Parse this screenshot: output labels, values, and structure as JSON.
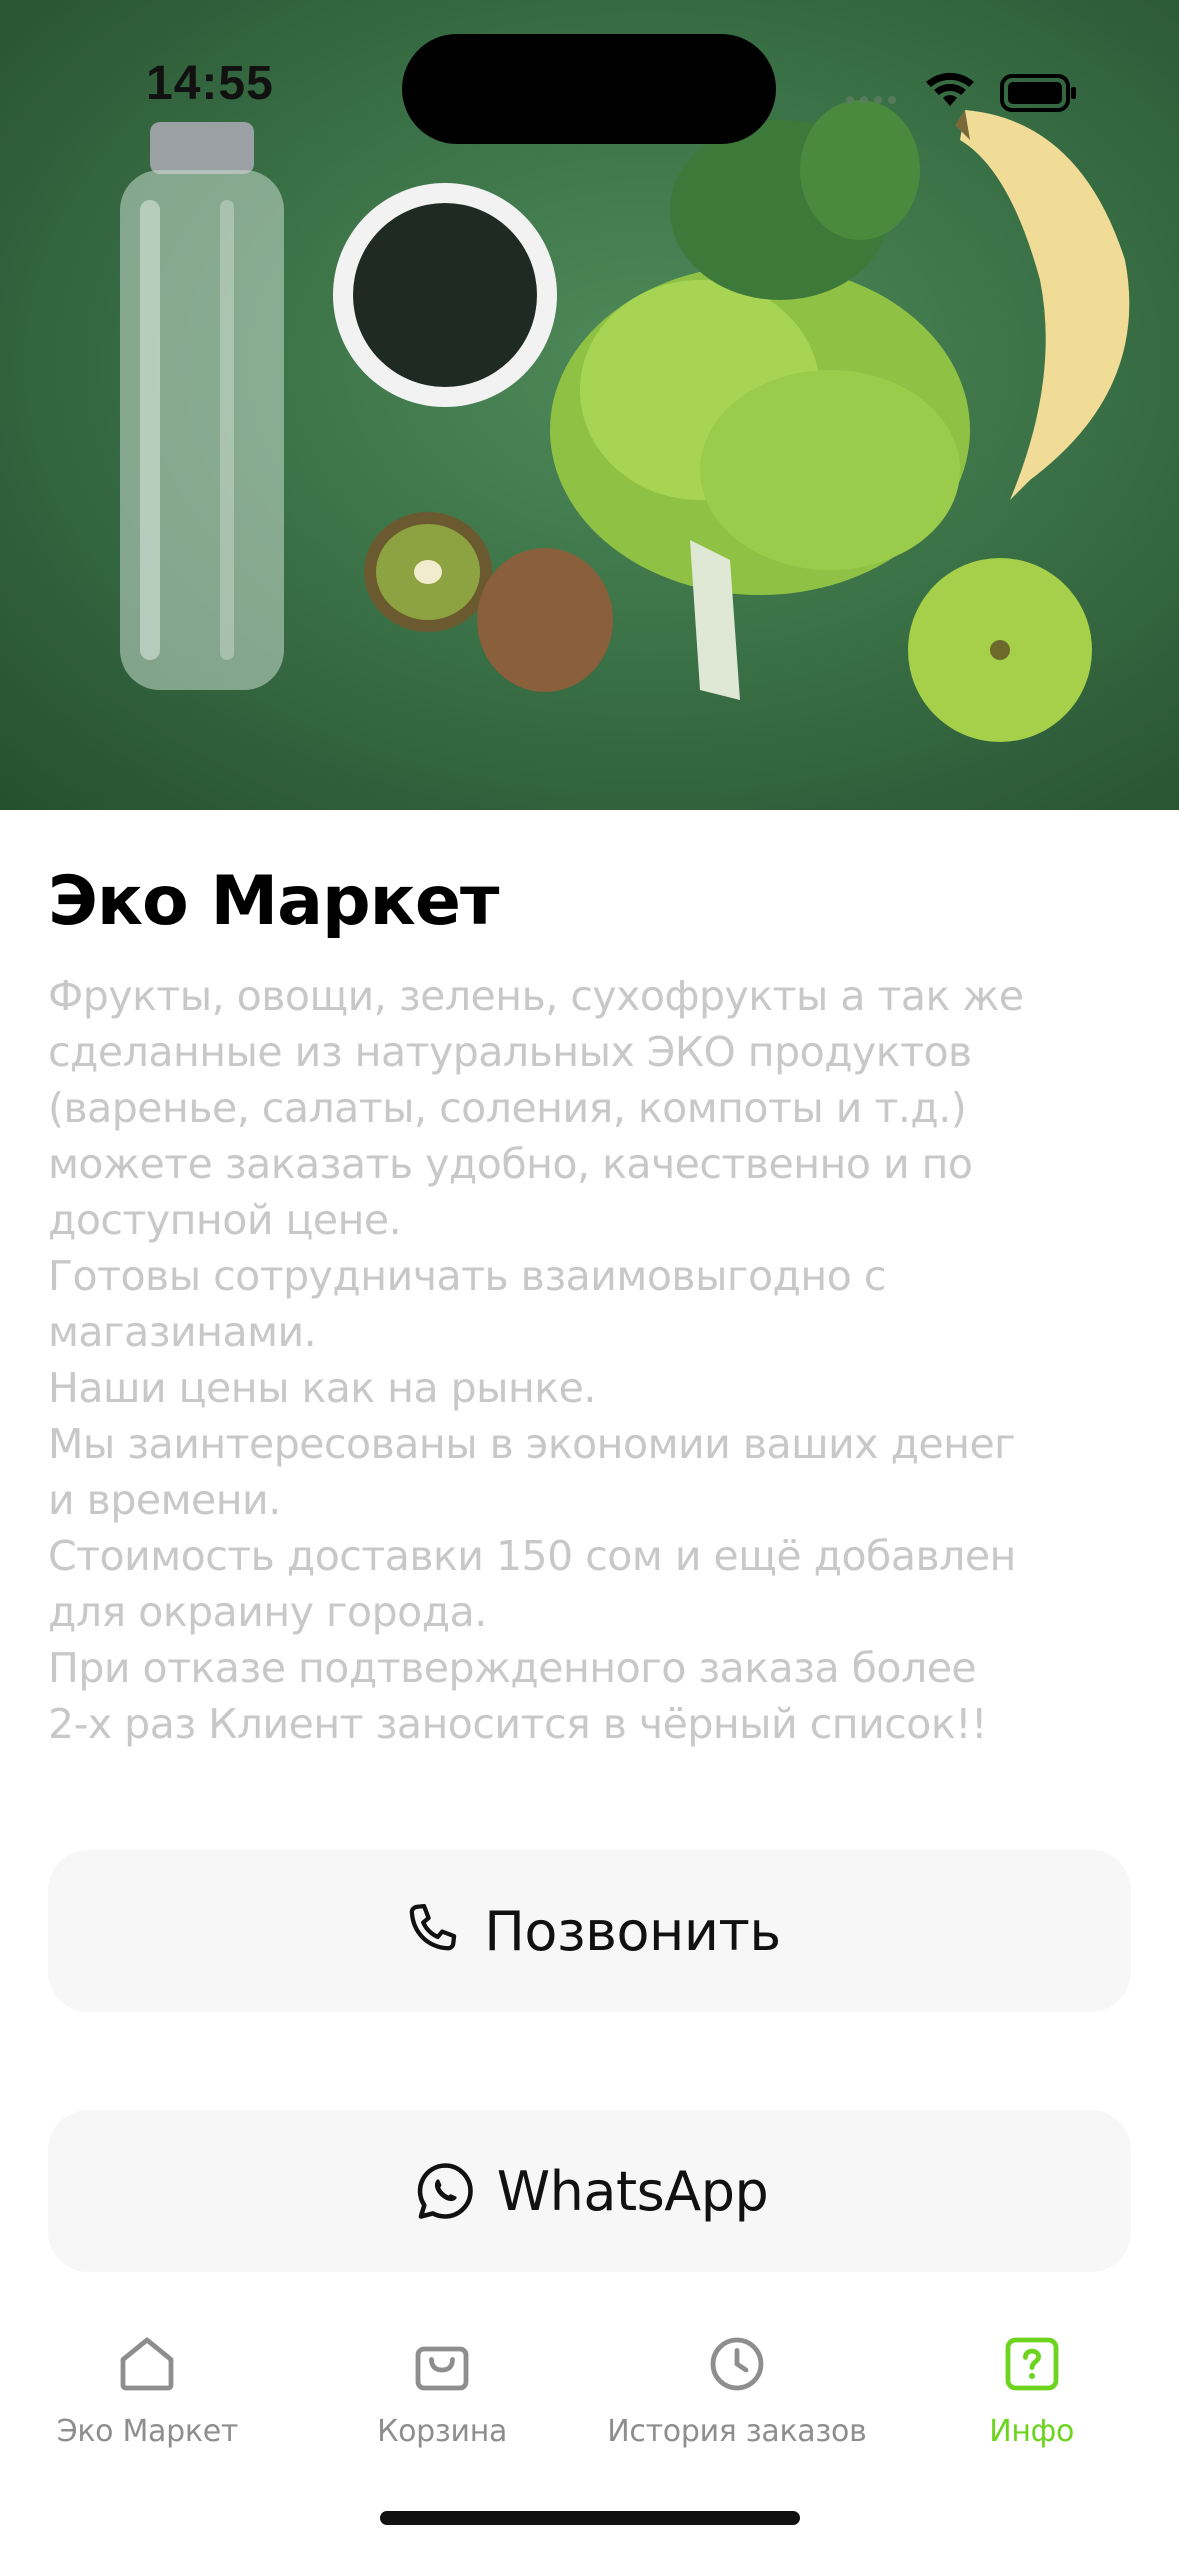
{
  "status_bar": {
    "time": "14:55"
  },
  "hero": {
    "image": "healthy-food-flatlay"
  },
  "store": {
    "title": "Эко Маркет",
    "description": "Фрукты, овощи, зелень, сухофрукты а так же\nсделанные из натуральных ЭКО продуктов\n(варенье, салаты, соления, компоты и т.д.)\nможете заказать удобно, качественно и по\nдоступной цене.\nГотовы сотрудничать взаимовыгодно с\nмагазинами.\nНаши цены как на рынке.\nМы заинтересованы в экономии ваших денег\nи времени.\nСтоимость доставки 150 сом и ещё добавлен\nдля окраину города.\nПри отказе подтвержденного заказа более\n2-х раз Клиент заносится в чёрный список!!"
  },
  "actions": {
    "call": {
      "label": "Позвонить",
      "icon": "phone-icon"
    },
    "whatsapp": {
      "label": "WhatsApp",
      "icon": "whatsapp-icon"
    }
  },
  "tabs": [
    {
      "label": "Эко Маркет",
      "icon": "home-icon",
      "active": false
    },
    {
      "label": "Корзина",
      "icon": "bag-icon",
      "active": false
    },
    {
      "label": "История заказов",
      "icon": "clock-icon",
      "active": false
    },
    {
      "label": "Инфо",
      "icon": "question-icon",
      "active": true
    }
  ],
  "colors": {
    "accent": "#6cd41e",
    "inactive_tab": "#8e8e8e",
    "description_text": "#c8c8c8",
    "button_bg": "#f7f7f7"
  }
}
